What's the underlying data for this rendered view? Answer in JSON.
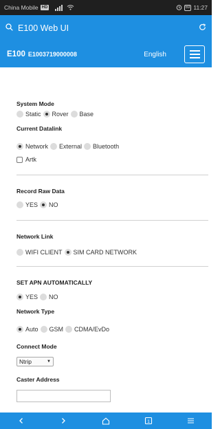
{
  "status_bar": {
    "carrier": "China Mobile",
    "network_badge": "HD",
    "battery": "69",
    "time": "11:27",
    "icons": [
      "signal-icon",
      "wifi-icon",
      "alarm-icon",
      "battery-icon"
    ]
  },
  "browser": {
    "page_title": "E100 Web UI",
    "icons": [
      "search-icon",
      "refresh-icon"
    ]
  },
  "header": {
    "app_name": "E100",
    "serial": "E1003719000008",
    "language": "English",
    "colors": {
      "bar": "#1e8fe1",
      "text": "#ffffff"
    }
  },
  "system_mode": {
    "label": "System Mode",
    "options": [
      "Static",
      "Rover",
      "Base"
    ],
    "selected": "Rover"
  },
  "current_datalink": {
    "label": "Current Datalink",
    "options": [
      "Network",
      "External",
      "Bluetooth"
    ],
    "selected": "Network",
    "checkbox_label": "Artk",
    "checkbox_checked": false
  },
  "record_raw_data": {
    "label": "Record Raw Data",
    "options": [
      "YES",
      "NO"
    ],
    "selected": "NO"
  },
  "network_link": {
    "label": "Network Link",
    "options": [
      "WIFI CLIENT",
      "SIM CARD NETWORK"
    ],
    "selected": "SIM CARD NETWORK"
  },
  "set_apn": {
    "label": "SET APN AUTOMATICALLY",
    "options": [
      "YES",
      "NO"
    ],
    "selected": "YES"
  },
  "network_type": {
    "label": "Network Type",
    "options": [
      "Auto",
      "GSM",
      "CDMA/EvDo"
    ],
    "selected": "Auto"
  },
  "connect_mode": {
    "label": "Connect Mode",
    "value": "Ntrip"
  },
  "caster_address": {
    "label": "Caster Address",
    "value": ""
  },
  "nav_bar": {
    "icons": [
      "back-icon",
      "forward-icon",
      "home-icon",
      "tabs-icon",
      "menu-icon"
    ],
    "tab_count": "1"
  }
}
